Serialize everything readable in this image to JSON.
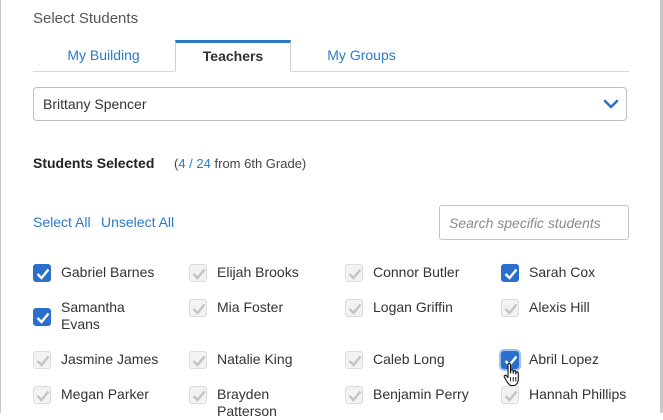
{
  "dialog": {
    "title": "Select Students"
  },
  "tabs": [
    {
      "label": "My Building"
    },
    {
      "label": "Teachers"
    },
    {
      "label": "My Groups"
    }
  ],
  "teacher_select": {
    "value": "Brittany Spencer"
  },
  "selection": {
    "heading": "Students Selected",
    "open_paren": "(",
    "count": "4 / 24",
    "suffix": "from 6th Grade)"
  },
  "links": {
    "select_all": "Select All",
    "unselect_all": "Unselect All"
  },
  "search": {
    "placeholder": "Search specific students"
  },
  "students": [
    {
      "name": "Gabriel Barnes",
      "state": "checked"
    },
    {
      "name": "Elijah Brooks",
      "state": "disabled"
    },
    {
      "name": "Connor Butler",
      "state": "disabled"
    },
    {
      "name": "Sarah Cox",
      "state": "checked"
    },
    {
      "name": "Samantha Evans",
      "state": "checked"
    },
    {
      "name": "Mia Foster",
      "state": "disabled"
    },
    {
      "name": "Logan Griffin",
      "state": "disabled"
    },
    {
      "name": "Alexis Hill",
      "state": "disabled"
    },
    {
      "name": "Jasmine James",
      "state": "disabled"
    },
    {
      "name": "Natalie King",
      "state": "disabled"
    },
    {
      "name": "Caleb Long",
      "state": "disabled"
    },
    {
      "name": "Abril Lopez",
      "state": "checked"
    },
    {
      "name": "Megan Parker",
      "state": "disabled"
    },
    {
      "name": "Brayden Patterson",
      "state": "disabled"
    },
    {
      "name": "Benjamin Perry",
      "state": "disabled"
    },
    {
      "name": "Hannah Phillips",
      "state": "disabled"
    }
  ],
  "colors": {
    "accent": "#2a7bc7",
    "checkbox_checked": "#2a6fcb",
    "checkbox_disabled": "#f2f2f2"
  }
}
